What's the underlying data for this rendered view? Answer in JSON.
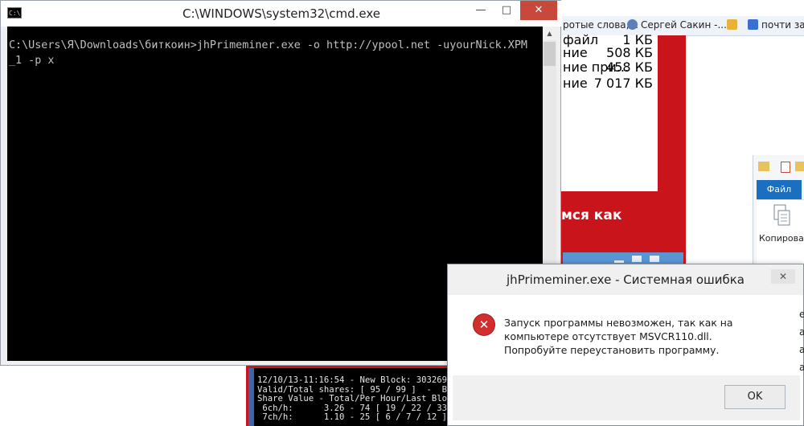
{
  "cmd_window": {
    "title": "C:\\WINDOWS\\system32\\cmd.exe",
    "icon_text": "C:\\.",
    "minimize": "—",
    "maximize": "□",
    "close": "✕",
    "console_lines": [
      "C:\\Users\\Я\\Downloads\\биткоин>jhPrimeminer.exe -o http://ypool.net -uyourNick.XPM",
      "_1 -p x"
    ]
  },
  "bookmarks": {
    "items": [
      {
        "label": "ротые слова,...",
        "color": "#6b8fd0"
      },
      {
        "label": "Сергей Сакин -...",
        "color": "#5c7fb8"
      },
      {
        "label": "",
        "color": "#e8b23a"
      },
      {
        "label": "почти зас",
        "color": "#3a6fd0"
      }
    ]
  },
  "explorer_list": {
    "rows": [
      {
        "name": "файл",
        "size": "1 КБ"
      },
      {
        "name": "ние",
        "size": "508 КБ"
      },
      {
        "name": "ние при...",
        "size": "458 КБ"
      },
      {
        "name": "ние",
        "size": "7 017 КБ"
      }
    ]
  },
  "web_page": {
    "heading_fragment": "мся как"
  },
  "explorer_right": {
    "file_tab": "Файл",
    "copy_label": "Копироват"
  },
  "miner_console": {
    "lines": [
      "12/10/13-11:16:54 - New Block: 303269",
      "Valid/Total shares: [ 95 / 99 ]  -  B",
      "Share Value - Total/Per Hour/Last Blo",
      " 6ch/h:      3.26 - 74 [ 19 / 22 / 33",
      " 7ch/h:      1.10 - 25 [ 6 / 7 / 12 ]"
    ]
  },
  "dialog": {
    "title": "jhPrimeminer.exe - Системная ошибка",
    "close": "✕",
    "icon": "error-icon",
    "message": "Запуск программы невозможен, так как на компьютере отсутствует MSVCR110.dll. Попробуйте переустановить программу.",
    "ok_label": "OK"
  },
  "right_edge_letters": "е а а а"
}
